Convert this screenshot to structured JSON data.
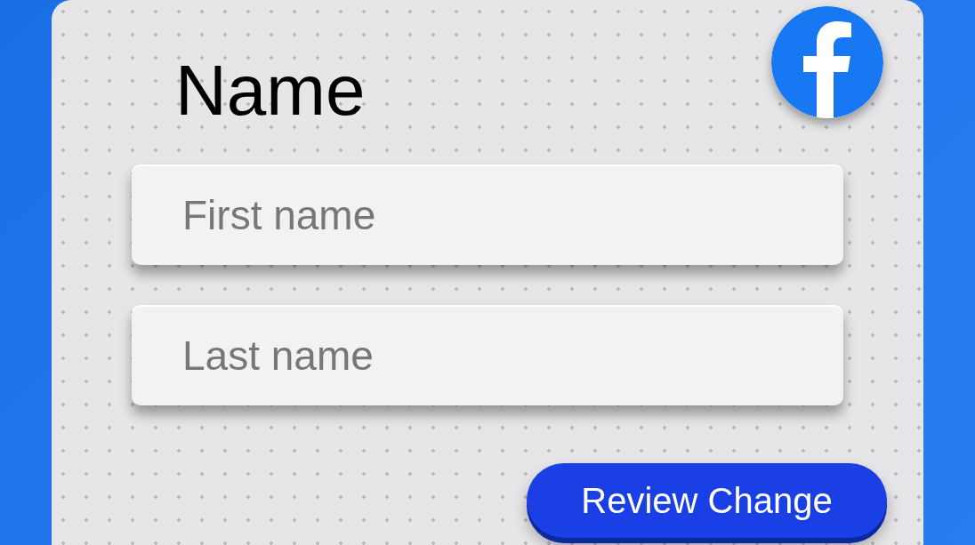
{
  "heading": "Name",
  "fields": [
    {
      "placeholder": "First name"
    },
    {
      "placeholder": "Last name"
    }
  ],
  "button": {
    "label": "Review Change"
  }
}
